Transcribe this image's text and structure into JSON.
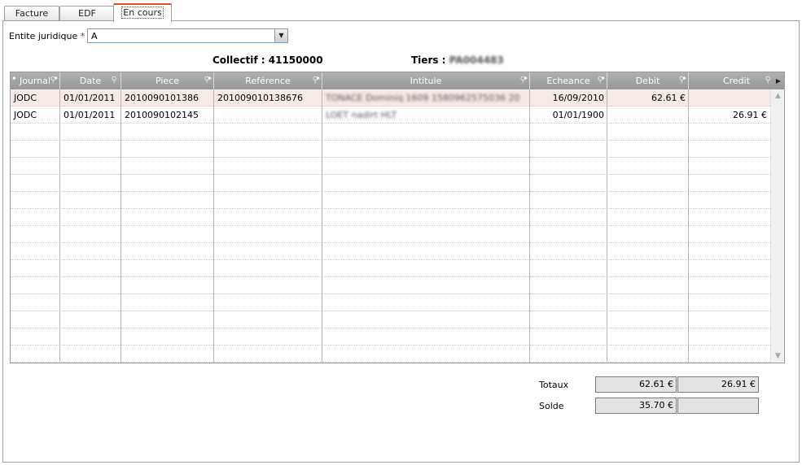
{
  "tabs": [
    {
      "label": "Facture"
    },
    {
      "label": "EDF"
    },
    {
      "label": "En cours"
    }
  ],
  "entity": {
    "label": "Entite juridique",
    "required_mark": "*",
    "value": "A"
  },
  "info": {
    "collectif": "Collectif : 41150000",
    "tiers_label": "Tiers :",
    "tiers_value": "PA004483"
  },
  "columns": [
    "Journal",
    "Date",
    "Piece",
    "Reférence",
    "Intitule",
    "Echeance",
    "Debit",
    "Credit"
  ],
  "rows": [
    {
      "journal": "JODC",
      "date": "01/01/2011",
      "piece": "2010090101386",
      "reference": "201009010138676",
      "intitule": "TONACE Dominiq 1609 1580962575036 20",
      "echeance": "16/09/2010",
      "debit": "62.61 €",
      "credit": ""
    },
    {
      "journal": "JODC",
      "date": "01/01/2011",
      "piece": "2010090102145",
      "reference": "",
      "intitule": "LOET nadirt HLT",
      "echeance": "01/01/1900",
      "debit": "",
      "credit": "26.91 €"
    }
  ],
  "totals": {
    "totaux_label": "Totaux",
    "totaux_debit": "62.61 €",
    "totaux_credit": "26.91 €",
    "solde_label": "Solde",
    "solde_debit": "35.70 €",
    "solde_credit": ""
  }
}
